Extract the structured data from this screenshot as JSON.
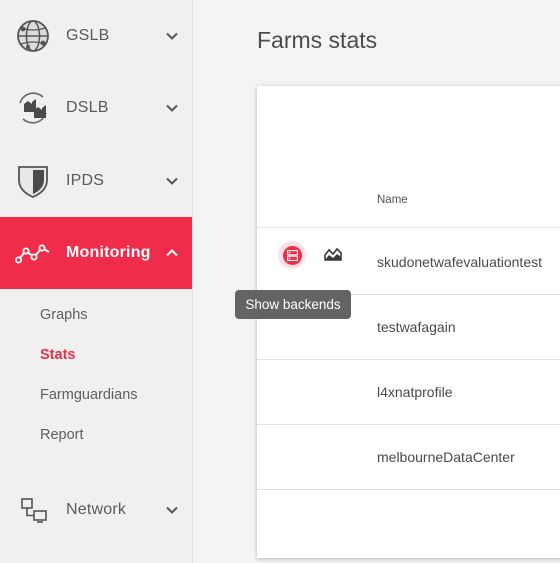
{
  "sidebar": {
    "items": [
      {
        "label": "GSLB",
        "icon": "globe-icon"
      },
      {
        "label": "DSLB",
        "icon": "datacenter-icon"
      },
      {
        "label": "IPDS",
        "icon": "shield-icon"
      },
      {
        "label": "Monitoring",
        "icon": "monitoring-icon",
        "expanded": true
      },
      {
        "label": "Network",
        "icon": "network-icon"
      }
    ],
    "monitoring_subitems": [
      {
        "label": "Graphs"
      },
      {
        "label": "Stats",
        "active": true
      },
      {
        "label": "Farmguardians"
      },
      {
        "label": "Report"
      }
    ]
  },
  "main": {
    "title": "Farms stats",
    "table": {
      "columns": [
        "Name"
      ],
      "rows": [
        {
          "name": "skudonetwafevaluationtest"
        },
        {
          "name": "testwafagain"
        },
        {
          "name": "l4xnatprofile"
        },
        {
          "name": "melbourneDataCenter"
        }
      ]
    },
    "tooltip": "Show backends"
  },
  "colors": {
    "accent": "#ef2c4a",
    "sidebar_bg": "#f0f0f0",
    "tooltip_bg": "#646464"
  }
}
